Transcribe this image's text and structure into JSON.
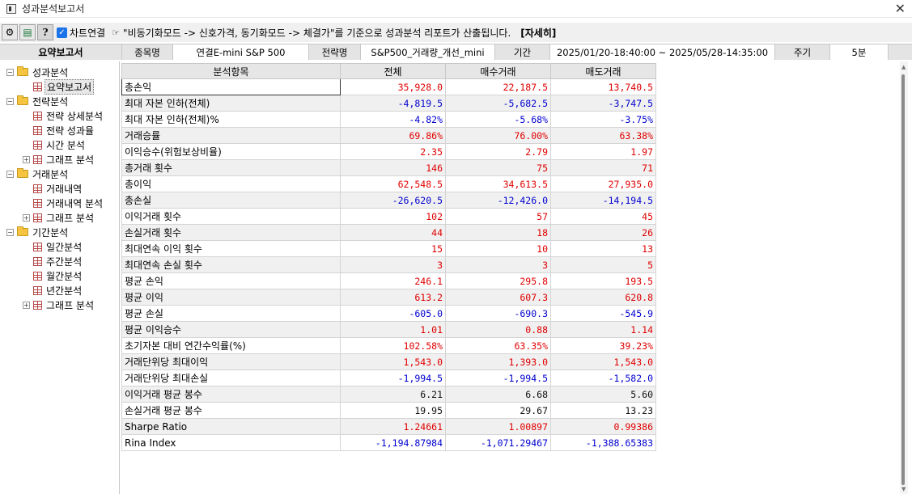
{
  "window": {
    "title": "성과분석보고서",
    "close_glyph": "✕"
  },
  "toolbar": {
    "settings_icon": "gear-icon",
    "export_icon": "excel-icon",
    "help_label": "?",
    "chart_link_checked": true,
    "chart_link_label": "차트연결",
    "note_icon": "hand-pointer-icon",
    "note_text": "\"비동기화모드 -> 신호가격, 동기화모드 -> 체결가\"를 기준으로 성과분석 리포트가 산출됩니다.",
    "detail_label": "[자세히]"
  },
  "infobar": {
    "section_title": "요약보고서",
    "symbol_label": "종목명",
    "symbol_value": "연결E-mini S&P 500",
    "strategy_label": "전략명",
    "strategy_value": "S&P500_거래량_개선_mini",
    "period_label": "기간",
    "period_value": "2025/01/20-18:40:00 ~ 2025/05/28-14:35:00",
    "cycle_label": "주기",
    "cycle_value": "5분"
  },
  "tree": [
    {
      "type": "folder",
      "label": "성과분석",
      "expander": "−",
      "level": 0
    },
    {
      "type": "leaf",
      "label": "요약보고서",
      "level": 1,
      "selected": true
    },
    {
      "type": "folder",
      "label": "전략분석",
      "expander": "−",
      "level": 0
    },
    {
      "type": "leaf",
      "label": "전략 상세분석",
      "level": 1
    },
    {
      "type": "leaf",
      "label": "전략 성과율",
      "level": 1
    },
    {
      "type": "leaf",
      "label": "시간 분석",
      "level": 1
    },
    {
      "type": "leaf",
      "label": "그래프 분석",
      "level": 1,
      "expander": "+"
    },
    {
      "type": "folder",
      "label": "거래분석",
      "expander": "−",
      "level": 0
    },
    {
      "type": "leaf",
      "label": "거래내역",
      "level": 1
    },
    {
      "type": "leaf",
      "label": "거래내역 분석",
      "level": 1
    },
    {
      "type": "leaf",
      "label": "그래프 분석",
      "level": 1,
      "expander": "+"
    },
    {
      "type": "folder",
      "label": "기간분석",
      "expander": "−",
      "level": 0
    },
    {
      "type": "leaf",
      "label": "일간분석",
      "level": 1
    },
    {
      "type": "leaf",
      "label": "주간분석",
      "level": 1
    },
    {
      "type": "leaf",
      "label": "월간분석",
      "level": 1
    },
    {
      "type": "leaf",
      "label": "년간분석",
      "level": 1
    },
    {
      "type": "leaf",
      "label": "그래프 분석",
      "level": 1,
      "expander": "+"
    }
  ],
  "table": {
    "headers": [
      "분석항목",
      "전체",
      "매수거래",
      "매도거래"
    ],
    "rows": [
      {
        "name": "총손익",
        "values": [
          "35,928.0",
          "22,187.5",
          "13,740.5"
        ],
        "color": "red"
      },
      {
        "name": "최대 자본 인하(전체)",
        "values": [
          "-4,819.5",
          "-5,682.5",
          "-3,747.5"
        ],
        "color": "blue"
      },
      {
        "name": "최대 자본 인하(전체)%",
        "values": [
          "-4.82%",
          "-5.68%",
          "-3.75%"
        ],
        "color": "blue"
      },
      {
        "name": "거래승률",
        "values": [
          "69.86%",
          "76.00%",
          "63.38%"
        ],
        "color": "red"
      },
      {
        "name": "이익승수(위험보상비율)",
        "values": [
          "2.35",
          "2.79",
          "1.97"
        ],
        "color": "red"
      },
      {
        "name": "총거래 횟수",
        "values": [
          "146",
          "75",
          "71"
        ],
        "color": "red"
      },
      {
        "name": "총이익",
        "values": [
          "62,548.5",
          "34,613.5",
          "27,935.0"
        ],
        "color": "red"
      },
      {
        "name": "총손실",
        "values": [
          "-26,620.5",
          "-12,426.0",
          "-14,194.5"
        ],
        "color": "blue"
      },
      {
        "name": "이익거래 횟수",
        "values": [
          "102",
          "57",
          "45"
        ],
        "color": "red"
      },
      {
        "name": "손실거래 횟수",
        "values": [
          "44",
          "18",
          "26"
        ],
        "color": "red"
      },
      {
        "name": "최대연속 이익 횟수",
        "values": [
          "15",
          "10",
          "13"
        ],
        "color": "red"
      },
      {
        "name": "최대연속 손실 횟수",
        "values": [
          "3",
          "3",
          "5"
        ],
        "color": "red"
      },
      {
        "name": "평균 손익",
        "values": [
          "246.1",
          "295.8",
          "193.5"
        ],
        "color": "red"
      },
      {
        "name": "평균 이익",
        "values": [
          "613.2",
          "607.3",
          "620.8"
        ],
        "color": "red"
      },
      {
        "name": "평균 손실",
        "values": [
          "-605.0",
          "-690.3",
          "-545.9"
        ],
        "color": "blue"
      },
      {
        "name": "평균 이익승수",
        "values": [
          "1.01",
          "0.88",
          "1.14"
        ],
        "color": "red"
      },
      {
        "name": "초기자본 대비 연간수익률(%)",
        "values": [
          "102.58%",
          "63.35%",
          "39.23%"
        ],
        "color": "red"
      },
      {
        "name": "거래단위당 최대이익",
        "values": [
          "1,543.0",
          "1,393.0",
          "1,543.0"
        ],
        "color": "red"
      },
      {
        "name": "거래단위당 최대손실",
        "values": [
          "-1,994.5",
          "-1,994.5",
          "-1,582.0"
        ],
        "color": "blue"
      },
      {
        "name": "이익거래 평균 봉수",
        "values": [
          "6.21",
          "6.68",
          "5.60"
        ],
        "color": "black"
      },
      {
        "name": "손실거래 평균 봉수",
        "values": [
          "19.95",
          "29.67",
          "13.23"
        ],
        "color": "black"
      },
      {
        "name": "Sharpe Ratio",
        "values": [
          "1.24661",
          "1.00897",
          "0.99386"
        ],
        "color": "red"
      },
      {
        "name": "Rina Index",
        "values": [
          "-1,194.87984",
          "-1,071.29467",
          "-1,388.65383"
        ],
        "color": "blue"
      }
    ]
  }
}
